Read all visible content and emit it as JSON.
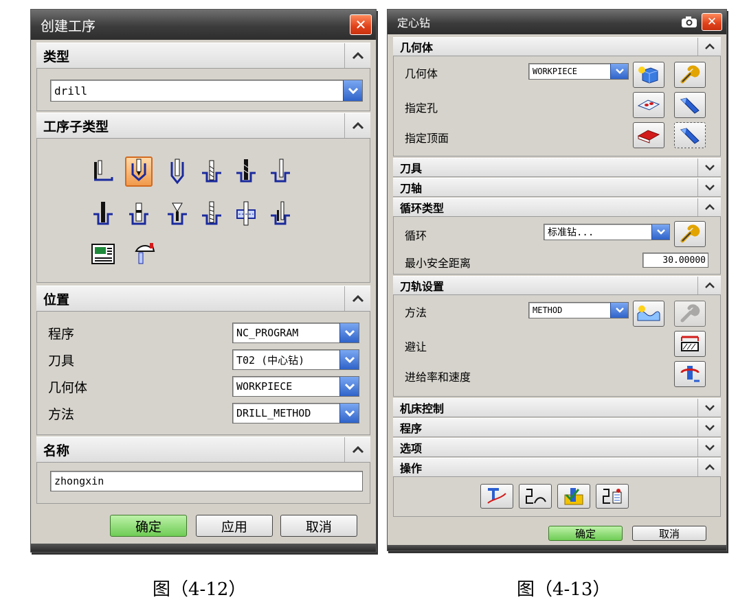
{
  "left_dialog": {
    "title": "创建工序",
    "close_glyph": "✕",
    "type_section": {
      "label": "类型",
      "value": "drill"
    },
    "subtype_section": {
      "label": "工序子类型"
    },
    "location_section": {
      "label": "位置",
      "rows": [
        {
          "label": "程序",
          "value": "NC_PROGRAM"
        },
        {
          "label": "刀具",
          "value": "T02 (中心钻)"
        },
        {
          "label": "几何体",
          "value": "WORKPIECE"
        },
        {
          "label": "方法",
          "value": "DRILL_METHOD"
        }
      ]
    },
    "name_section": {
      "label": "名称",
      "value": "zhongxin"
    },
    "buttons": {
      "ok": "确定",
      "apply": "应用",
      "cancel": "取消"
    }
  },
  "right_dialog": {
    "title": "定心钻",
    "geometry_section": {
      "label": "几何体",
      "geometry_label": "几何体",
      "geometry_value": "WORKPIECE",
      "hole_label": "指定孔",
      "top_label": "指定顶面"
    },
    "tool_section": {
      "label": "刀具"
    },
    "axis_section": {
      "label": "刀轴"
    },
    "cycle_section": {
      "label": "循环类型",
      "cycle_label": "循环",
      "cycle_value": "标准钻...",
      "clearance_label": "最小安全距离",
      "clearance_value": "30.00000"
    },
    "path_section": {
      "label": "刀轨设置",
      "method_label": "方法",
      "method_value": "METHOD",
      "avoid_label": "避让",
      "feeds_label": "进给率和速度"
    },
    "machine_section": {
      "label": "机床控制"
    },
    "program_section": {
      "label": "程序"
    },
    "options_section": {
      "label": "选项"
    },
    "actions_section": {
      "label": "操作"
    },
    "buttons": {
      "ok": "确定",
      "cancel": "取消"
    }
  },
  "captions": {
    "left": "图（4-12）",
    "right": "图（4-13）"
  },
  "colors": {
    "title_bar": "#3c3c3c",
    "close_button": "#e0421a",
    "dropdown_arrow": "#2f63c9",
    "ok_button": "#6fcc55",
    "selected_tile": "#f19a4c"
  }
}
